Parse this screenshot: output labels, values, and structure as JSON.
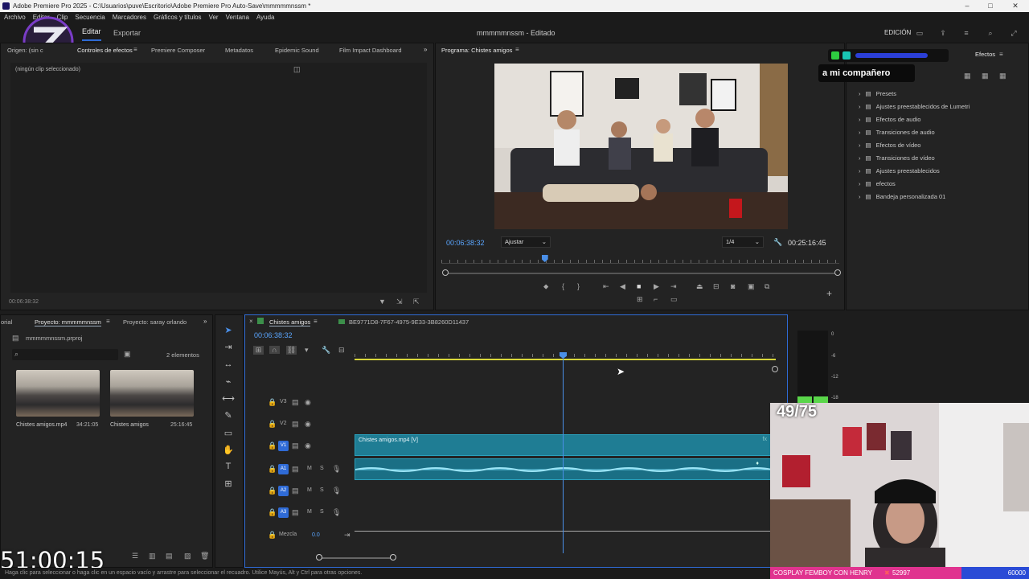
{
  "window": {
    "title": "Adobe Premiere Pro 2025 - C:\\Usuarios\\puve\\Escritorio\\Adobe Premiere Pro Auto-Save\\mmmmmnssm *"
  },
  "menu": [
    "Archivo",
    "Editar",
    "Clip",
    "Secuencia",
    "Marcadores",
    "Gráficos y títulos",
    "Ver",
    "Ventana",
    "Ayuda"
  ],
  "appbar": {
    "tabs": [
      "Editar",
      "Exportar"
    ],
    "project_status": "mmmmmnssm - Editado",
    "workspace": "EDICIÓN"
  },
  "source_panel": {
    "tabs": [
      "Origen: (sin c",
      "Controles de efectos",
      "Premiere Composer",
      "Metadatos",
      "Epidemic Sound",
      "Film Impact Dashboard"
    ],
    "empty": "(ningún clip seleccionado)",
    "timecode": "00:06:38:32"
  },
  "program": {
    "title": "Programa: Chistes amigos",
    "timecode": "00:06:38:32",
    "zoom": "Ajustar",
    "resolution": "1/4",
    "duration": "00:25:16:45",
    "playhead_fraction": 0.26
  },
  "project": {
    "tabs": [
      "orial",
      "Proyecto: mmmmmnssm",
      "Proyecto: saray orlando"
    ],
    "file": "mmmmmnssm.prproj",
    "count": "2 elementos",
    "items": [
      {
        "name": "Chistes amigos.mp4",
        "duration": "34:21:05"
      },
      {
        "name": "Chistes amigos",
        "duration": "25:16:45"
      }
    ]
  },
  "timeline": {
    "tabs": [
      "Chistes amigos",
      "BE9771D8-7F67-4975-9E33-3B8260D11437"
    ],
    "timecode": "00:06:38:32",
    "tracks": [
      "V3",
      "V2",
      "V1",
      "A1",
      "A2",
      "A3"
    ],
    "mix_label": "Mezcla",
    "mix_value": "0.0",
    "clip_label": "Chistes amigos.mp4 [V]",
    "playhead_fraction": 0.5
  },
  "meter": {
    "labels": [
      "0",
      "-6",
      "-12",
      "-18"
    ]
  },
  "effects": {
    "tab": "Efectos",
    "folders": [
      "Presets",
      "Ajustes preestablecidos de Lumetri",
      "Efectos de audio",
      "Transiciones de audio",
      "Efectos de vídeo",
      "Transiciones de vídeo",
      "Ajustes preestablecidos",
      "efectos",
      "Bandeja personalizada 01"
    ]
  },
  "overlay": {
    "counter": "49/75",
    "chat": "a mi compañero",
    "big_clock": "51:00:15",
    "banner": "COSPLAY FEMBOY CON HENRY",
    "banner_count": "52997",
    "banner_goal": "60000"
  },
  "status": {
    "text": "Haga clic para seleccionar o haga clic en un espacio vacío y arrastre para seleccionar el recuadro. Utilice Mayús, Alt y Ctrl para otras opciones."
  },
  "colors": {
    "accent": "#2f6bd6",
    "clip": "#1f7d94",
    "timecode": "#5aa6ff",
    "banner": "#e0338f"
  }
}
